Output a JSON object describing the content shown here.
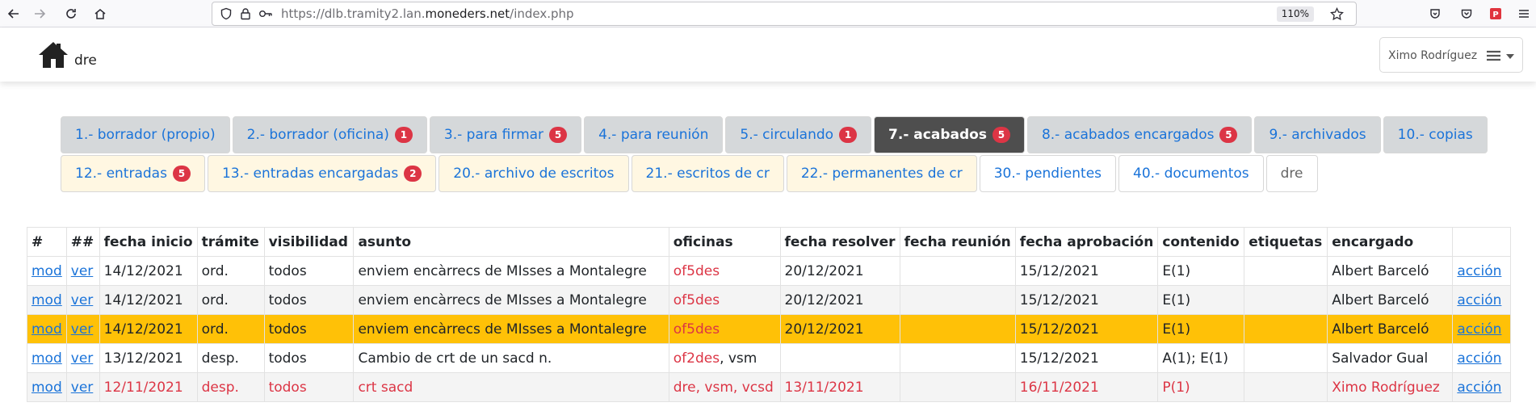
{
  "browser": {
    "url_prefix": "https://dlb.tramity2.lan.",
    "url_domain": "moneders.net",
    "url_suffix": "/index.php",
    "zoom": "110%"
  },
  "header": {
    "brand": "dre",
    "user": "Ximo Rodríguez"
  },
  "tabs_row1": [
    {
      "label": "1.- borrador (propio)",
      "badge": ""
    },
    {
      "label": "2.- borrador (oficina)",
      "badge": "1"
    },
    {
      "label": "3.- para firmar",
      "badge": "5"
    },
    {
      "label": "4.- para reunión",
      "badge": ""
    },
    {
      "label": "5.- circulando",
      "badge": "1"
    },
    {
      "label": "7.- acabados",
      "badge": "5"
    },
    {
      "label": "8.- acabados encargados",
      "badge": "5"
    },
    {
      "label": "9.- archivados",
      "badge": ""
    },
    {
      "label": "10.- copias",
      "badge": ""
    }
  ],
  "tabs_row2": [
    {
      "label": "12.- entradas",
      "badge": "5"
    },
    {
      "label": "13.- entradas encargadas",
      "badge": "2"
    },
    {
      "label": "20.- archivo de escritos",
      "badge": ""
    },
    {
      "label": "21.- escritos de cr",
      "badge": ""
    },
    {
      "label": "22.- permanentes de cr",
      "badge": ""
    },
    {
      "label": "30.- pendientes",
      "badge": ""
    },
    {
      "label": "40.- documentos",
      "badge": ""
    },
    {
      "label": "dre",
      "badge": ""
    }
  ],
  "table": {
    "headers": [
      "#",
      "##",
      "fecha inicio",
      "trámite",
      "visibilidad",
      "asunto",
      "oficinas",
      "fecha resolver",
      "fecha reunión",
      "fecha aprobación",
      "contenido",
      "etiquetas",
      "encargado",
      ""
    ],
    "rows": [
      {
        "mod": "mod",
        "ver": "ver",
        "inicio": "14/12/2021",
        "tramite": "ord.",
        "visibilidad": "todos",
        "asunto": "enviem encàrrecs de MIsses a Montalegre",
        "oficina_main": "of5des",
        "oficina_rest": "",
        "resolver": "20/12/2021",
        "reunion": "",
        "aprobacion": "15/12/2021",
        "contenido": "E(1)",
        "etiquetas": "",
        "encargado": "Albert Barceló",
        "accion": "acción"
      },
      {
        "mod": "mod",
        "ver": "ver",
        "inicio": "14/12/2021",
        "tramite": "ord.",
        "visibilidad": "todos",
        "asunto": "enviem encàrrecs de MIsses a Montalegre",
        "oficina_main": "of5des",
        "oficina_rest": "",
        "resolver": "20/12/2021",
        "reunion": "",
        "aprobacion": "15/12/2021",
        "contenido": "E(1)",
        "etiquetas": "",
        "encargado": "Albert Barceló",
        "accion": "acción"
      },
      {
        "mod": "mod",
        "ver": "ver",
        "inicio": "14/12/2021",
        "tramite": "ord.",
        "visibilidad": "todos",
        "asunto": "enviem encàrrecs de MIsses a Montalegre",
        "oficina_main": "of5des",
        "oficina_rest": "",
        "resolver": "20/12/2021",
        "reunion": "",
        "aprobacion": "15/12/2021",
        "contenido": "E(1)",
        "etiquetas": "",
        "encargado": "Albert Barceló",
        "accion": "acción"
      },
      {
        "mod": "mod",
        "ver": "ver",
        "inicio": "13/12/2021",
        "tramite": "desp.",
        "visibilidad": "todos",
        "asunto": "Cambio de crt de un sacd n.",
        "oficina_main": "of2des",
        "oficina_rest": ", vsm",
        "resolver": "",
        "reunion": "",
        "aprobacion": "15/12/2021",
        "contenido": "A(1); E(1)",
        "etiquetas": "",
        "encargado": "Salvador Gual",
        "accion": "acción"
      },
      {
        "mod": "mod",
        "ver": "ver",
        "inicio": "12/11/2021",
        "tramite": "desp.",
        "visibilidad": "todos",
        "asunto": "crt sacd",
        "oficina_main": "dre, vsm, vcsd",
        "oficina_rest": "",
        "resolver": "13/11/2021",
        "reunion": "",
        "aprobacion": "16/11/2021",
        "contenido": "P(1)",
        "etiquetas": "",
        "encargado": "Ximo Rodríguez",
        "accion": "acción"
      }
    ]
  },
  "colors": {
    "accent": "#1a73d9",
    "selected_row": "#ffc107",
    "badge": "#dc3545",
    "active_tab": "#4e4e4e",
    "alert_text": "#dc3545"
  }
}
